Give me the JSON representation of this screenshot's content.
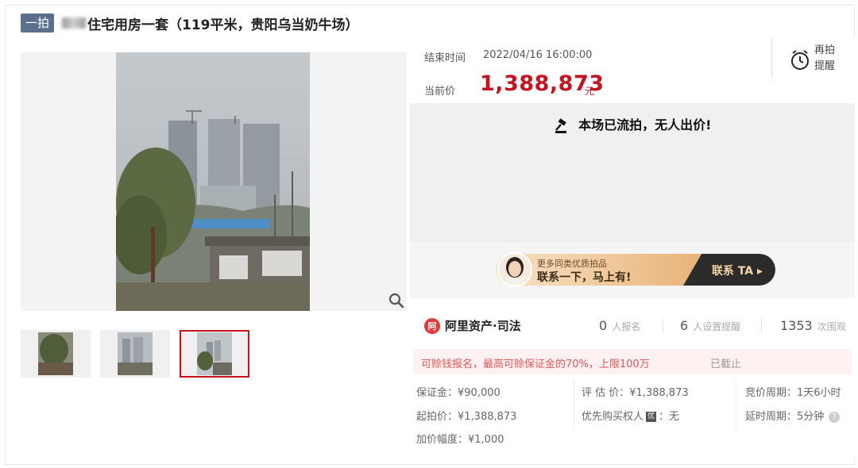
{
  "title": {
    "tag": "一拍",
    "text": "住宅用房一套（119平米，贵阳乌当奶牛场）"
  },
  "auction": {
    "end_time_label": "结束时间",
    "end_time": "2022/04/16 16:00:00",
    "current_price_label": "当前价",
    "current_price": "1,388,873",
    "currency_unit": "元",
    "reminder_label": "再拍提醒",
    "status_text": "本场已流拍，无人出价!"
  },
  "banner": {
    "small_text": "更多同类优质拍品",
    "big_text": "联系一下，马上有!",
    "cta_label": "联系 TA ▸"
  },
  "platform": {
    "logo_mark": "阿",
    "name": "阿里资产·司法"
  },
  "stats": {
    "registrations": "0",
    "registrations_label": "人报名",
    "reminders": "6",
    "reminders_label": "人设置提醒",
    "views": "1353",
    "views_label": "次围观"
  },
  "loan": {
    "text": "可赊钱报名，最高可赊保证金的70%，上限100万",
    "status": "已截止"
  },
  "details": {
    "deposit": "保证金：¥90,000",
    "starting_price": "起拍价：¥1,388,873",
    "increment": "加价幅度：¥1,000",
    "appraisal": "评 估 价：¥1,388,873",
    "priority_label": "优先购买权人",
    "priority_badge": "优",
    "priority_value": "：无",
    "cycle": "竞价周期：1天6小时",
    "extension": "延时周期：5分钟"
  },
  "icons": {
    "zoom": "magnifier-icon",
    "clock": "alarm-clock-icon",
    "gavel": "gavel-icon",
    "help": "question-icon"
  },
  "colors": {
    "price_red": "#c7131d",
    "tag_blue": "#5c6f8c",
    "loan_text": "#e15656"
  }
}
